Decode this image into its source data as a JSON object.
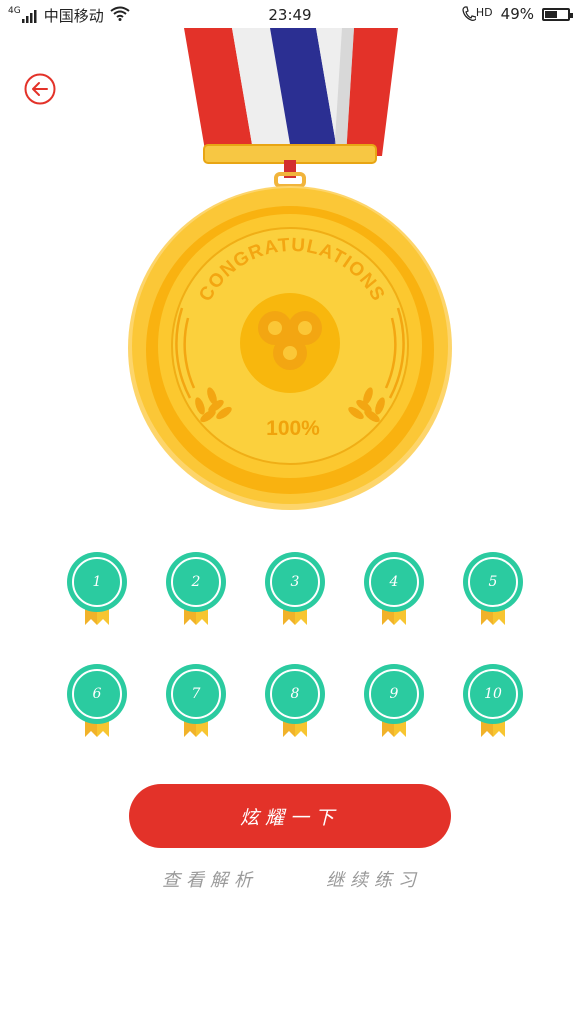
{
  "status_bar": {
    "network": "4G",
    "carrier": "中国移动",
    "time": "23:49",
    "hd": "HD",
    "battery_text": "49%",
    "battery_level": 0.49
  },
  "medal": {
    "ring_text": "CONGRATULATIONS",
    "score": "100%"
  },
  "badges": [
    "1",
    "2",
    "3",
    "4",
    "5",
    "6",
    "7",
    "8",
    "9",
    "10"
  ],
  "actions": {
    "share_label": "炫耀一下",
    "view_analysis": "查看解析",
    "continue_practice": "继续练习"
  },
  "colors": {
    "accent_red": "#e33229",
    "badge_teal": "#2bcba0",
    "medal_gold": "#fbc02d",
    "ribbon_blue": "#2b2f92"
  }
}
